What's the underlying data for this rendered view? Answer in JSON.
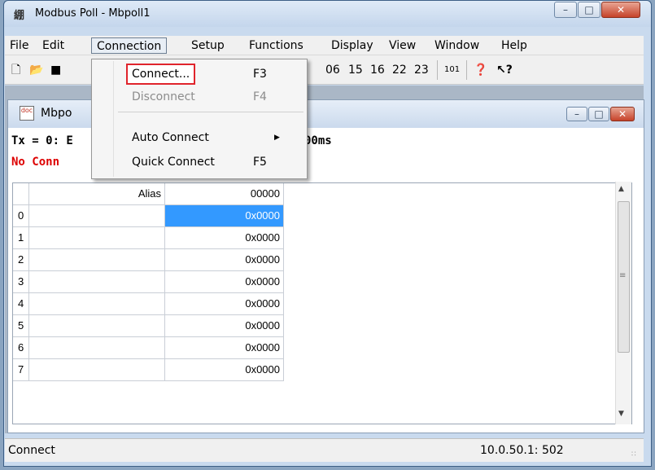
{
  "window": {
    "title": "Modbus Poll - Mbpoll1",
    "icon": "modbus-app-icon"
  },
  "menubar": [
    "File",
    "Edit",
    "Connection",
    "Setup",
    "Functions",
    "Display",
    "View",
    "Window",
    "Help"
  ],
  "toolbar": {
    "fc_labels": [
      "06",
      "15",
      "16",
      "22",
      "23"
    ],
    "fc_101": "101",
    "icons": [
      "new-file-icon",
      "open-folder-icon",
      "save-icon",
      "help-icon",
      "context-help-icon"
    ]
  },
  "connection_menu": {
    "items": [
      {
        "label": "Connect...",
        "shortcut": "F3",
        "state": "highlighted"
      },
      {
        "label": "Disconnect",
        "shortcut": "F4",
        "state": "disabled"
      },
      {
        "label": "Auto Connect",
        "shortcut": "",
        "submenu": true
      },
      {
        "label": "Quick Connect",
        "shortcut": "F5"
      }
    ]
  },
  "child_window": {
    "title": "Mbpo",
    "tx_line": "Tx = 0: E",
    "tx_line_suffix": "00ms",
    "status": "No Conn",
    "status_color": "#dd0000"
  },
  "grid": {
    "header": {
      "alias": "Alias",
      "col0": "00000"
    },
    "rows": [
      {
        "index": "0",
        "alias": "",
        "value": "0x0000"
      },
      {
        "index": "1",
        "alias": "",
        "value": "0x0000"
      },
      {
        "index": "2",
        "alias": "",
        "value": "0x0000"
      },
      {
        "index": "3",
        "alias": "",
        "value": "0x0000"
      },
      {
        "index": "4",
        "alias": "",
        "value": "0x0000"
      },
      {
        "index": "5",
        "alias": "",
        "value": "0x0000"
      },
      {
        "index": "6",
        "alias": "",
        "value": "0x0000"
      },
      {
        "index": "7",
        "alias": "",
        "value": "0x0000"
      }
    ],
    "selected_color": "#3399ff"
  },
  "statusbar": {
    "left": "Connect",
    "right": "10.0.50.1: 502"
  }
}
